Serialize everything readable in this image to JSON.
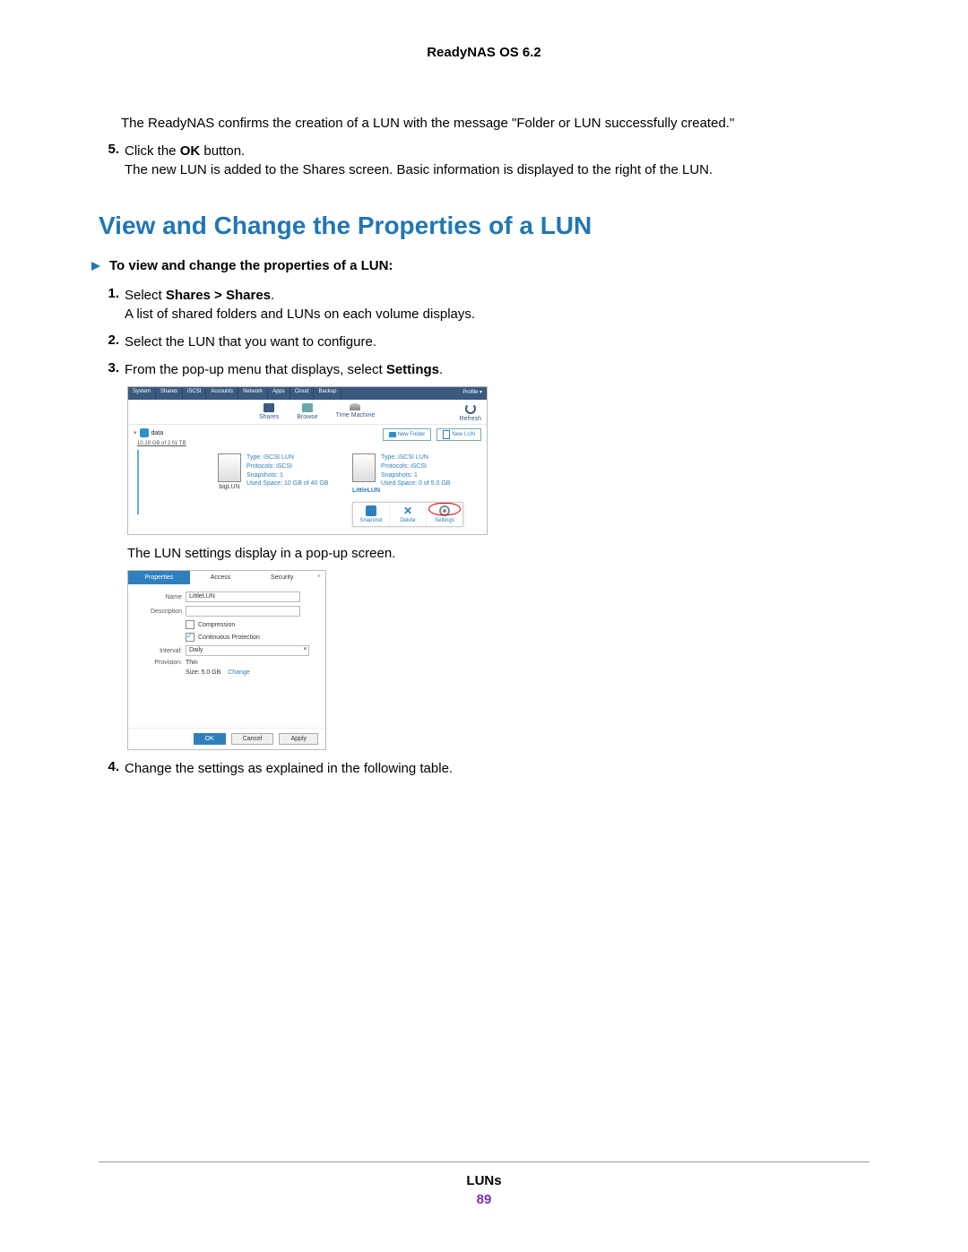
{
  "header": {
    "title": "ReadyNAS OS 6.2"
  },
  "intro": {
    "confirm_text": "The ReadyNAS confirms the creation of a LUN with the message \"Folder or LUN successfully created.\"",
    "step5_num": "5.",
    "step5_line1a": "Click the ",
    "step5_line1b": "OK",
    "step5_line1c": " button.",
    "step5_line2": "The new LUN is added to the Shares screen. Basic information is displayed to the right of the LUN."
  },
  "heading": "View and Change the Properties of a LUN",
  "proc_heading": "To view and change the properties of a LUN:",
  "steps": {
    "s1_num": "1.",
    "s1a": "Select ",
    "s1b": "Shares > Shares",
    "s1c": ".",
    "s1_line2": "A list of shared folders and LUNs on each volume displays.",
    "s2_num": "2.",
    "s2": "Select the LUN that you want to configure.",
    "s3_num": "3.",
    "s3a": "From the pop-up menu that displays, select ",
    "s3b": "Settings",
    "s3c": ".",
    "after_shot1": "The LUN settings display in a pop-up screen.",
    "s4_num": "4.",
    "s4": "Change the settings as explained in the following table."
  },
  "shot1": {
    "tabs": [
      "System",
      "Shares",
      "iSCSI",
      "Accounts",
      "Network",
      "Apps",
      "Cloud",
      "Backup"
    ],
    "profile": "Profile ▾",
    "toolbar": {
      "shares": "Shares",
      "browse": "Browse",
      "timemachine": "Time Machine",
      "refresh": "Refresh"
    },
    "volume": {
      "name": "data",
      "cap": "10.19 GB of 2.01 TB"
    },
    "btn_newfolder": "New Folder",
    "btn_newlun": "New LUN",
    "lun_left": {
      "name": "bigLUN",
      "l1": "Type: iSCSI LUN",
      "l2": "Protocols: iSCSI",
      "l3": "Snapshots: 1",
      "l4": "Used Space: 10 GB of 40 GB"
    },
    "lun_right": {
      "name": "LittleLUN",
      "l1": "Type: iSCSI LUN",
      "l2": "Protocols: iSCSI",
      "l3": "Snapshots: 1",
      "l4": "Used Space: 0 of 5.0 GB"
    },
    "popup": {
      "snapshot": "Snapshot",
      "delete": "Delete",
      "settings": "Settings"
    }
  },
  "shot2": {
    "tabs": {
      "properties": "Properties",
      "access": "Access",
      "security": "Security"
    },
    "form": {
      "name_lbl": "Name",
      "name_val": "LittleLUN",
      "desc_lbl": "Description",
      "desc_val": "",
      "compression": "Compression",
      "continuous": "Continuous Protection",
      "interval_lbl": "Interval:",
      "interval_val": "Daily",
      "provision_lbl": "Provision:",
      "provision_val": "Thin",
      "size_lbl": "Size: 5.0 GB",
      "size_link": "Change"
    },
    "buttons": {
      "ok": "OK",
      "cancel": "Cancel",
      "apply": "Apply"
    }
  },
  "footer": {
    "label": "LUNs",
    "page": "89"
  }
}
